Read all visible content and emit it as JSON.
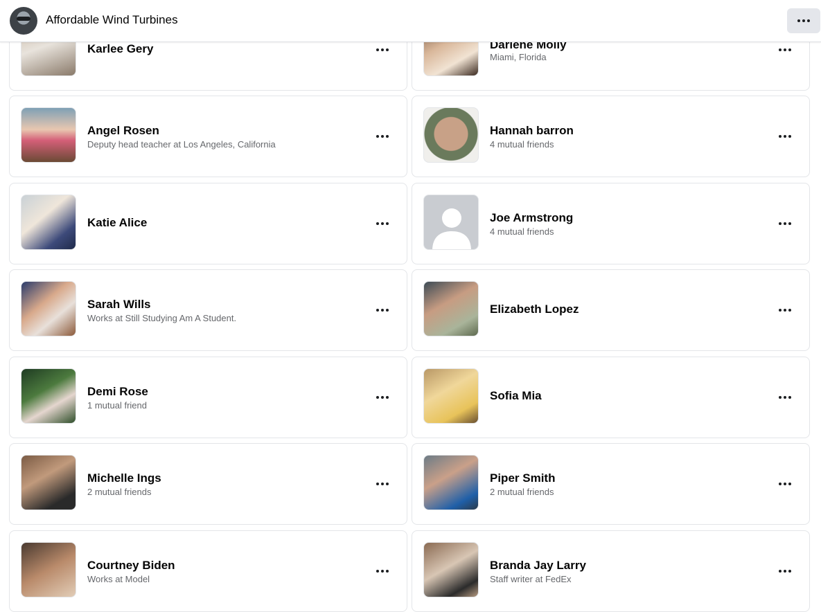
{
  "header": {
    "page_name": "Affordable Wind Turbines",
    "more_icon": "more-horizontal-icon"
  },
  "friends": [
    {
      "name": "Karlee Gery",
      "subtitle": ""
    },
    {
      "name": "Darlene Molly",
      "subtitle": "Miami, Florida"
    },
    {
      "name": "Angel Rosen",
      "subtitle": "Deputy head teacher at Los Angeles, California"
    },
    {
      "name": "Hannah barron",
      "subtitle": "4 mutual friends"
    },
    {
      "name": "Katie Alice",
      "subtitle": ""
    },
    {
      "name": "Joe Armstrong",
      "subtitle": "4 mutual friends"
    },
    {
      "name": "Sarah Wills",
      "subtitle": "Works at Still Studying Am A Student."
    },
    {
      "name": "Elizabeth Lopez",
      "subtitle": ""
    },
    {
      "name": "Demi Rose",
      "subtitle": "1 mutual friend"
    },
    {
      "name": "Sofia Mia",
      "subtitle": ""
    },
    {
      "name": "Michelle Ings",
      "subtitle": "2 mutual friends"
    },
    {
      "name": "Piper Smith",
      "subtitle": "2 mutual friends"
    },
    {
      "name": "Courtney Biden",
      "subtitle": "Works at Model"
    },
    {
      "name": "Branda Jay Larry",
      "subtitle": "Staff writer at FedEx"
    }
  ]
}
